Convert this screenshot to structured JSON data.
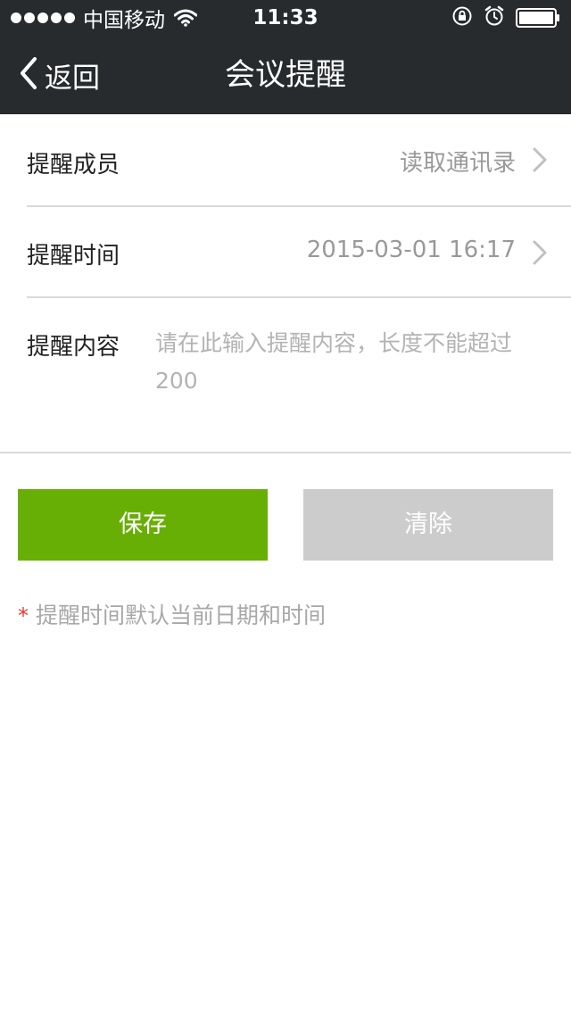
{
  "status_bar": {
    "carrier": "中国移动",
    "time": "11:33",
    "icons": [
      "signal-dots",
      "wifi-icon",
      "rotation-lock-icon",
      "alarm-icon",
      "battery-icon"
    ]
  },
  "nav": {
    "back_label": "返回",
    "title": "会议提醒"
  },
  "form": {
    "members": {
      "label": "提醒成员",
      "value": "读取通讯录"
    },
    "time": {
      "label": "提醒时间",
      "value": "2015-03-01 16:17"
    },
    "content": {
      "label": "提醒内容",
      "placeholder": "请在此输入提醒内容，长度不能超过200"
    }
  },
  "buttons": {
    "save": "保存",
    "clear": "清除"
  },
  "note": {
    "star": "*",
    "text": "提醒时间默认当前日期和时间"
  },
  "colors": {
    "header_bg": "#272b2e",
    "save_green": "#68af05",
    "clear_gray": "#cccccc",
    "note_star_red": "#e53935"
  }
}
